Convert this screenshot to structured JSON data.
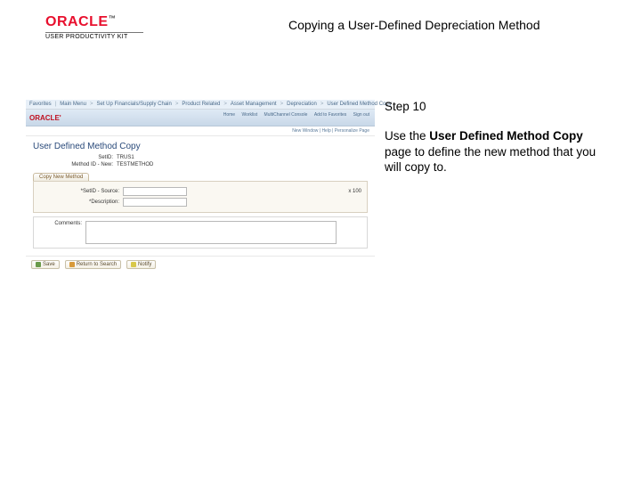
{
  "logo": {
    "brand": "ORACLE",
    "tm": "™",
    "subline": "USER PRODUCTIVITY KIT"
  },
  "title": "Copying a User-Defined Depreciation Method",
  "instructions": {
    "step_label": "Step 10",
    "body_prefix": "Use the ",
    "body_bold": "User Defined Method Copy",
    "body_suffix": " page to define the new method that you will copy to."
  },
  "screenshot": {
    "nav": {
      "items": [
        "Favorites",
        "Main Menu",
        "Set Up Financials/Supply Chain",
        "Product Related",
        "Asset Management",
        "Depreciation",
        "User Defined Method Copy"
      ]
    },
    "hdr": {
      "brand": "ORACLE'",
      "links_row1": [
        "Home",
        "Worklist",
        "MultiChannel Console",
        "Add to Favorites",
        "Sign out"
      ],
      "links_row2": "New Window | Help | Personalize Page"
    },
    "page_title": "User Defined Method Copy",
    "fields": {
      "setid_label": "SetID:",
      "setid_value": "TRUS1",
      "method_label": "Method ID - New:",
      "method_value": "TESTMETHOD"
    },
    "tab": "Copy New Method",
    "copy_panel": {
      "method_label": "*SetID - Source:",
      "method_input_value": "",
      "percent_label": "",
      "percent_value": "x 100"
    },
    "desc": {
      "label": "*Description:"
    },
    "buttons": {
      "save": "Save",
      "return": "Return to Search",
      "notify": "Notify"
    }
  }
}
